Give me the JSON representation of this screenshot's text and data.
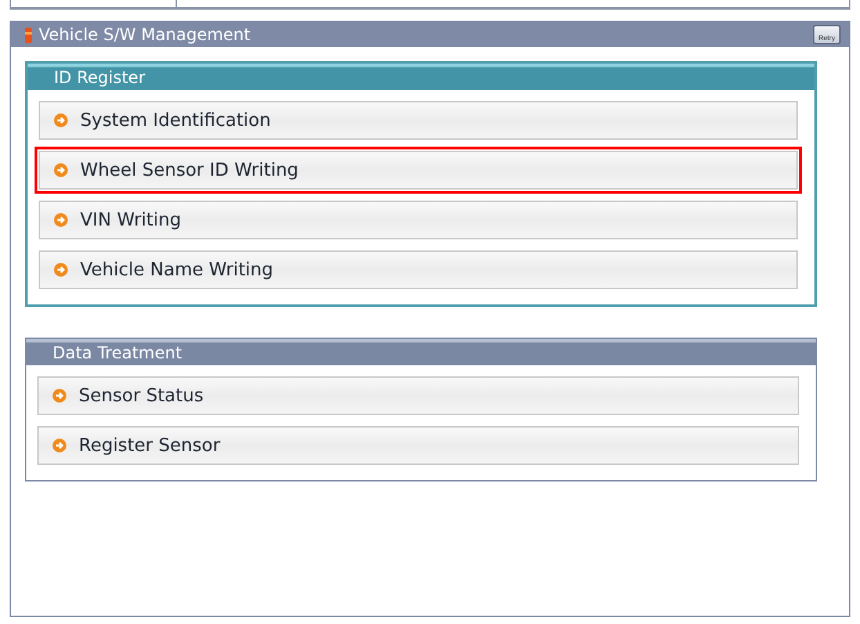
{
  "window": {
    "title": "Vehicle S/W Management",
    "retry_label": "Retry"
  },
  "groups": [
    {
      "title": "ID Register",
      "kind": "teal",
      "items": [
        {
          "label": "System Identification",
          "selected": false
        },
        {
          "label": "Wheel Sensor ID Writing",
          "selected": true
        },
        {
          "label": "VIN Writing",
          "selected": false
        },
        {
          "label": "Vehicle Name Writing",
          "selected": false
        }
      ]
    },
    {
      "title": "Data Treatment",
      "kind": "slate",
      "items": [
        {
          "label": "Sensor Status",
          "selected": false
        },
        {
          "label": "Register Sensor",
          "selected": false
        }
      ]
    }
  ]
}
